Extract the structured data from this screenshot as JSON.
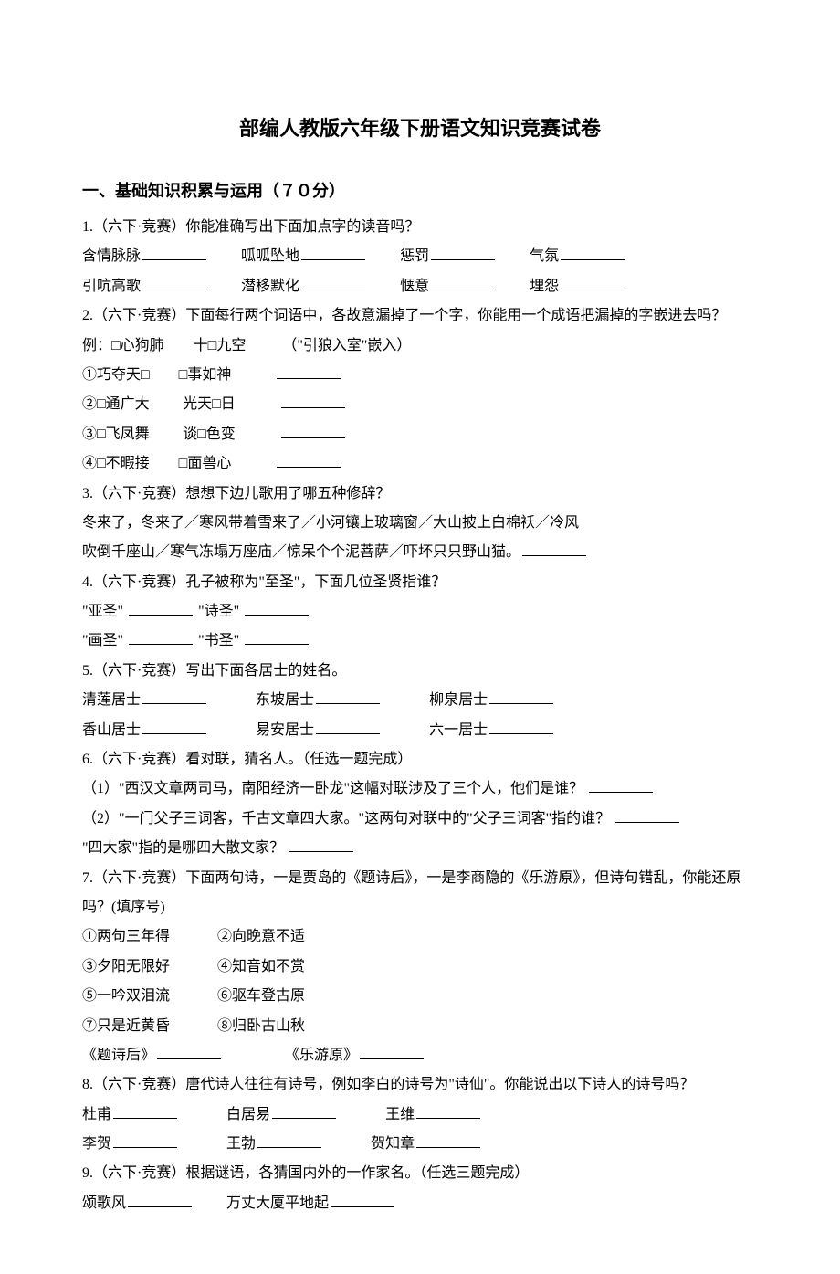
{
  "title": "部编人教版六年级下册语文知识竞赛试卷",
  "section": "一、基础知识积累与运用（７０分）",
  "q1": {
    "prompt": "1.（六下·竞赛）你能准确写出下面加点字的读音吗？",
    "row1": {
      "a": "含情脉脉",
      "b": "呱呱坠地",
      "c": "惩罚",
      "d": "气氛"
    },
    "row2": {
      "a": "引吭高歌",
      "b": "潜移默化",
      "c": "惬意",
      "d": "埋怨"
    }
  },
  "q2": {
    "prompt": "2.（六下·竞赛）下面每行两个词语中，各故意漏掉了一个字，你能用一个成语把漏掉的字嵌进去吗？",
    "example": "例：□心狗肺　　十□九空　　　（\"引狼入室\"嵌入）",
    "item1": "①巧夺天□　　□事如神",
    "item2": "②□通广大　　 光天□日",
    "item3": "③□飞凤舞　　 谈□色变",
    "item4": "④□不暇接　　□面兽心"
  },
  "q3": {
    "prompt": "3.（六下·竞赛）想想下边儿歌用了哪五种修辞？",
    "line1": "冬来了，冬来了／寒风带着雪来了／小河镶上玻璃窗／大山披上白棉袄／冷风",
    "line2": "吹倒千座山／寒气冻塌万座庙／惊呆个个泥菩萨／吓坏只只野山猫。"
  },
  "q4": {
    "prompt": "4.（六下·竞赛）孔子被称为\"至圣\"，下面几位圣贤指谁？",
    "row1": {
      "a": "\"亚圣\"",
      "b": "\"诗圣\""
    },
    "row2": {
      "a": "\"画圣\"",
      "b": "\"书圣\""
    }
  },
  "q5": {
    "prompt": "5.（六下·竞赛）写出下面各居士的姓名。",
    "row1": {
      "a": "清莲居士",
      "b": "东坡居士",
      "c": "柳泉居士"
    },
    "row2": {
      "a": "香山居士",
      "b": "易安居士",
      "c": "六一居士"
    }
  },
  "q6": {
    "prompt": "6.（六下·竞赛）看对联，猜名人。（任选一题完成）",
    "item1": "（1）\"西汉文章两司马，南阳经济一卧龙\"这幅对联涉及了三个人，他们是谁？",
    "item2": "（2）\"一门父子三词客，千古文章四大家。\"这两句对联中的\"父子三词客\"指的谁？",
    "item3": "\"四大家\"指的是哪四大散文家？"
  },
  "q7": {
    "prompt1": "7.（六下·竞赛）下面两句诗，一是贾岛的《题诗后》，一是李商隐的《乐游原》，但诗句错乱，你能还原",
    "prompt2": "吗？(填序号)",
    "opt1": "①两句三年得",
    "opt2": "②向晚意不适",
    "opt3": "③夕阳无限好",
    "opt4": "④知音如不赏",
    "opt5": "⑤一吟双泪流",
    "opt6": "⑥驱车登古原",
    "opt7": "⑦只是近黄昏",
    "opt8": "⑧归卧古山秋",
    "ans1": "《题诗后》",
    "ans2": "《乐游原》"
  },
  "q8": {
    "prompt": "8.（六下·竞赛）唐代诗人往往有诗号，例如李白的诗号为\"诗仙\"。你能说出以下诗人的诗号吗？",
    "row1": {
      "a": "杜甫",
      "b": "白居易",
      "c": "王维"
    },
    "row2": {
      "a": "李贺",
      "b": "王勃",
      "c": "贺知章"
    }
  },
  "q9": {
    "prompt": "9.（六下·竞赛）根据谜语，各猜国内外的一作家名。（任选三题完成）",
    "row1": {
      "a": "颂歌风",
      "b": "万丈大厦平地起"
    }
  }
}
